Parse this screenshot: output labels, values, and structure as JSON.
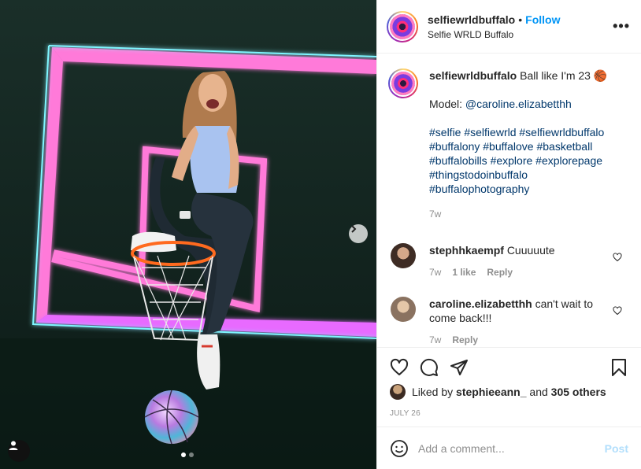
{
  "header": {
    "username": "selfiewrldbuffalo",
    "separator": "•",
    "follow_label": "Follow",
    "location": "Selfie WRLD Buffalo",
    "more_label": "•••"
  },
  "caption": {
    "username": "selfiewrldbuffalo",
    "text": "Ball like I'm 23 🏀",
    "model_prefix": "Model:",
    "model_mention": "@caroline.elizabetthh",
    "hashtag_lines": [
      "#selfie #selfiewrld #selfiewrldbuffalo",
      "#buffalony #buffalove #basketball",
      "#buffalobills #explore #explorepage",
      "#thingstodoinbuffalo",
      "#buffalophotography"
    ],
    "time": "7w"
  },
  "comments": [
    {
      "username": "stephhkaempf",
      "text": "Cuuuuute",
      "time": "7w",
      "likes": "1 like",
      "reply": "Reply",
      "avatar_color": "#6b5a4e"
    },
    {
      "username": "caroline.elizabetthh",
      "text": "can't wait to come back!!!",
      "time": "7w",
      "likes": "",
      "reply": "Reply",
      "avatar_color": "#c8b39a"
    }
  ],
  "likes": {
    "prefix": "Liked by",
    "user": "stephieeann_",
    "middle": "and",
    "others": "305 others"
  },
  "date": "JULY 26",
  "add_comment": {
    "placeholder": "Add a comment...",
    "post_label": "Post"
  },
  "carousel": {
    "total": 2,
    "current": 1
  },
  "colors": {
    "accent": "#0095f6",
    "link": "#00376b",
    "muted": "#8e8e8e",
    "neon_pink": "#ff4fd8",
    "neon_cyan": "#4ff2ff"
  }
}
